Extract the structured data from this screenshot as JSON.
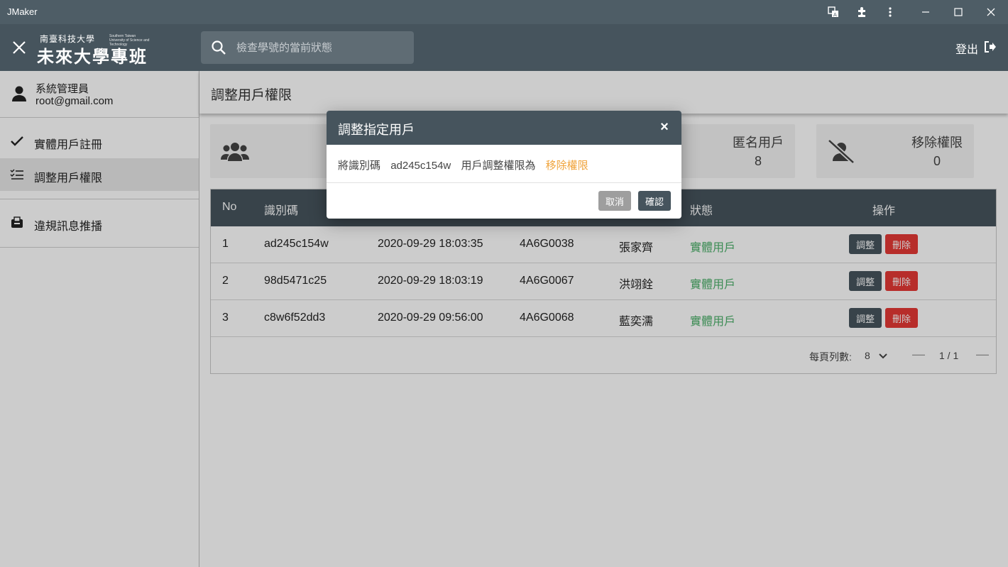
{
  "window": {
    "title": "JMaker",
    "controls": [
      "translate-icon",
      "extension-icon",
      "more-vert-icon",
      "minimize-icon",
      "maximize-icon",
      "close-icon"
    ]
  },
  "header": {
    "logo": {
      "small": "南臺科技大學",
      "small_en": "Southern Taiwan University of Science and Technology",
      "big": "未來大學專班"
    },
    "search": {
      "placeholder": "檢查學號的當前狀態",
      "value": ""
    },
    "logout_label": "登出"
  },
  "sidebar": {
    "user": {
      "name": "系統管理員",
      "email": "root@gmail.com"
    },
    "items": [
      {
        "label": "實體用戶註冊",
        "icon": "check-icon",
        "active": false
      },
      {
        "label": "調整用戶權限",
        "icon": "checklist-icon",
        "active": true
      },
      {
        "label": "違規訊息推播",
        "icon": "mail-box-icon",
        "active": false
      }
    ]
  },
  "main": {
    "title": "調整用戶權限",
    "stats": [
      {
        "icon": "users-icon"
      },
      {
        "label": "匿名用戶",
        "value": "8"
      },
      {
        "label": "移除權限",
        "value": "0",
        "icon": "user-slash-icon"
      }
    ],
    "table": {
      "columns": [
        "No",
        "識別碼",
        "",
        "",
        "",
        "狀態",
        "操作"
      ],
      "rows": [
        {
          "no": "1",
          "id": "ad245c154w",
          "time": "2020-09-29 18:03:35",
          "student_id": "4A6G0038",
          "name": "張家齊",
          "status": "實體用戶"
        },
        {
          "no": "2",
          "id": "98d5471c25",
          "time": "2020-09-29 18:03:19",
          "student_id": "4A6G0067",
          "name": "洪翊銓",
          "status": "實體用戶"
        },
        {
          "no": "3",
          "id": "c8w6f52dd3",
          "time": "2020-09-29 09:56:00",
          "student_id": "4A6G0068",
          "name": "藍奕濡",
          "status": "實體用戶"
        }
      ],
      "adjust_label": "調整",
      "delete_label": "刪除"
    },
    "pager": {
      "rows_per_page_label": "每頁列數:",
      "rows_per_page": "8",
      "page_info": "1 / 1",
      "prev": "—",
      "next": "—"
    }
  },
  "modal": {
    "title": "調整指定用戶",
    "close": "×",
    "msg_prefix": "將識別碼",
    "msg_id": "ad245c154w",
    "msg_middle": "用戶調整權限為",
    "msg_target": "移除權限",
    "cancel_label": "取消",
    "confirm_label": "確認"
  },
  "colors": {
    "header_bg": "#46545d",
    "titlebar_bg": "#4e5d66",
    "status_green": "#4caf6a",
    "delete_red": "#e53935",
    "highlight_orange": "#f0a33a"
  }
}
